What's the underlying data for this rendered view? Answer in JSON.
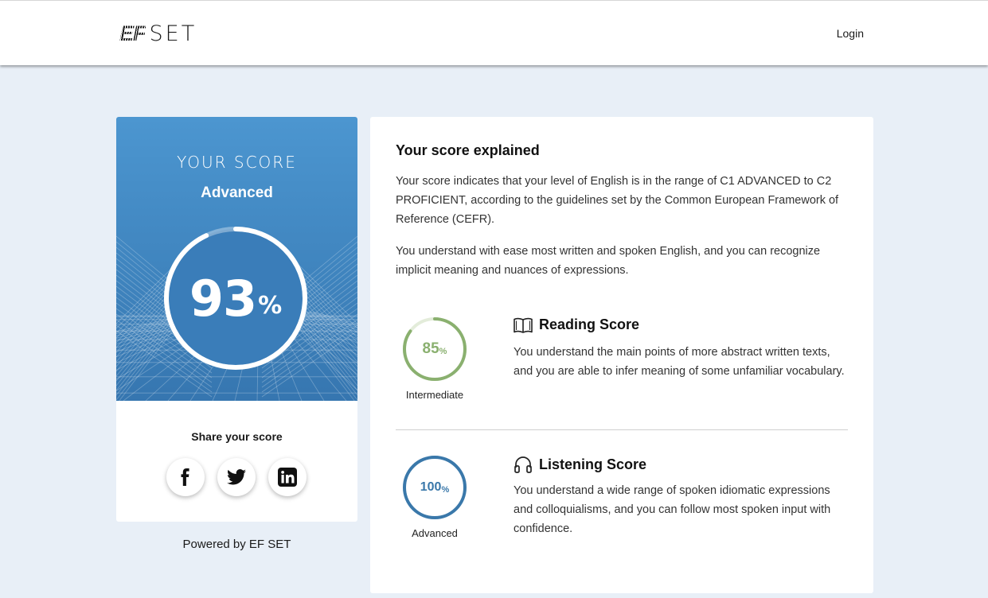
{
  "header": {
    "logo_ef": "EF",
    "logo_set": "SET",
    "login_label": "Login"
  },
  "score_card": {
    "heading": "YOUR SCORE",
    "level": "Advanced",
    "score_number": "93",
    "score_unit": "%",
    "score_fraction": 0.93,
    "share_title": "Share your score",
    "share_buttons": [
      {
        "icon": "facebook-icon"
      },
      {
        "icon": "twitter-icon"
      },
      {
        "icon": "linkedin-icon"
      }
    ]
  },
  "powered_by": "Powered by EF SET",
  "explained": {
    "title": "Your score explained",
    "paragraph_1": "Your score indicates that your level of English is in the range of C1 ADVANCED to C2 PROFICIENT, according to the guidelines set by the Common European Framework of Reference (CEFR).",
    "paragraph_2": "You understand with ease most written and spoken English, and you can recognize implicit meaning and nuances of expressions.",
    "sections": [
      {
        "title": "Reading Score",
        "icon": "book-icon",
        "score_number": "85",
        "score_unit": "%",
        "score_fraction": 0.85,
        "level": "Intermediate",
        "color": "#8ab06f",
        "description": "You understand the main points of more abstract written texts, and you are able to infer meaning of some unfamiliar vocabulary."
      },
      {
        "title": "Listening Score",
        "icon": "headphones-icon",
        "score_number": "100",
        "score_unit": "%",
        "score_fraction": 1.0,
        "level": "Advanced",
        "color": "#3a78aa",
        "description": "You understand a wide range of spoken idiomatic expressions and colloquialisms, and you can follow most spoken input with confidence."
      }
    ]
  }
}
